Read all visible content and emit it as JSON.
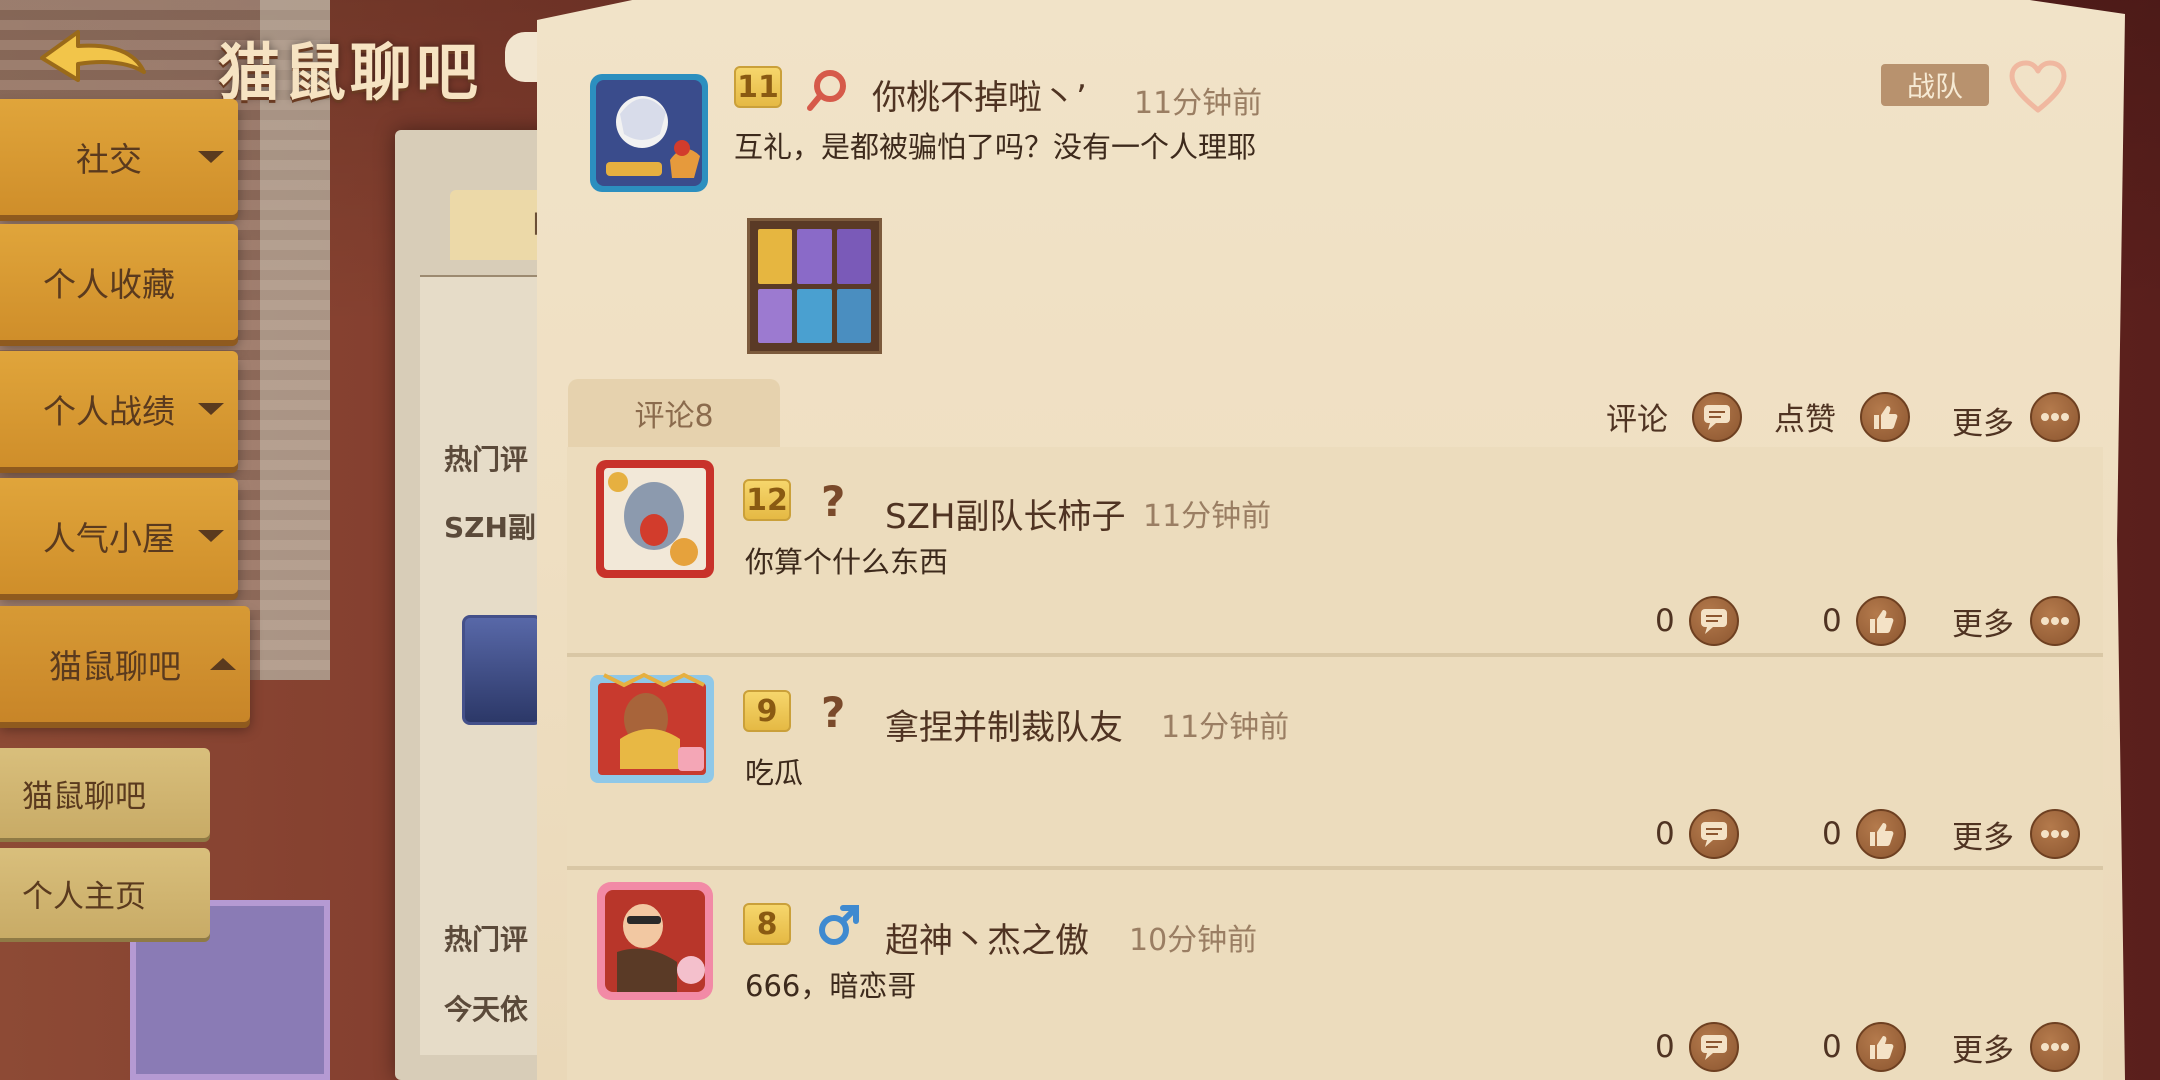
{
  "page": {
    "title": "猫鼠聊吧"
  },
  "sidebar": {
    "items": [
      {
        "label": "社交",
        "caret": "down"
      },
      {
        "label": "个人收藏",
        "caret": "none"
      },
      {
        "label": "个人战绩",
        "caret": "down"
      },
      {
        "label": "人气小屋",
        "caret": "down"
      },
      {
        "label": "猫鼠聊吧",
        "caret": "up"
      }
    ],
    "sub_items": [
      {
        "label": "猫鼠聊吧"
      },
      {
        "label": "个人主页"
      }
    ]
  },
  "background": {
    "hints": [
      "热门评",
      "SZH副队",
      "热门评",
      "今天依"
    ],
    "tab_stub": "R"
  },
  "post": {
    "level": "11",
    "user_name": "你桃不掉啦丶ʼ",
    "time": "11分钟前",
    "content": "互礼，是都被骗怕了吗？没有一个人理耶",
    "team_label": "战队",
    "actions": {
      "comment_label": "评论",
      "like_label": "点赞",
      "more_label": "更多"
    },
    "comment_tab": "评论8"
  },
  "comments": [
    {
      "level": "12",
      "gender": "?",
      "user_name": "SZH副队长柿子",
      "time": "11分钟前",
      "content": "你算个什么东西",
      "comment_count": "0",
      "like_count": "0",
      "more_label": "更多"
    },
    {
      "level": "9",
      "gender": "?",
      "user_name": "拿捏并制裁队友",
      "time": "11分钟前",
      "content": "吃瓜",
      "comment_count": "0",
      "like_count": "0",
      "more_label": "更多"
    },
    {
      "level": "8",
      "gender": "male",
      "user_name": "超神丶杰之傲",
      "time": "10分钟前",
      "content": "666，暗恋哥",
      "comment_count": "0",
      "like_count": "0",
      "more_label": "更多"
    }
  ],
  "colors": {
    "sidebar_button": "#e0a53b",
    "panel_paper": "#f1e3c8",
    "level_badge": "#f6d66c",
    "icon_button": "#8c5630",
    "heart_outline": "#f0b8a0"
  }
}
